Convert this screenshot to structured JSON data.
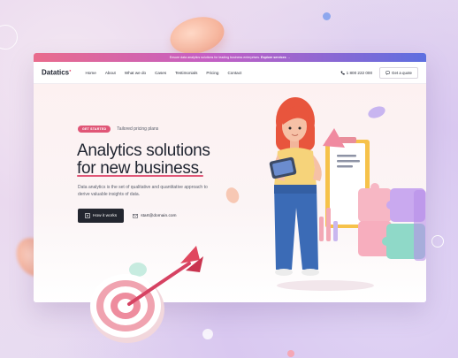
{
  "promo": {
    "text": "Ensure data analytics solutions for leading business enterprises.",
    "link": "Explore services →"
  },
  "nav": {
    "logo": "Datatics",
    "links": [
      "Home",
      "About",
      "What we do",
      "Cases",
      "Testimonials",
      "Pricing",
      "Contact"
    ],
    "phone": "1 800 222 000",
    "quote_button": "Get a quote"
  },
  "hero": {
    "tag": "GET STARTED",
    "tag_caption": "Tailored pricing plans",
    "headline_line1": "Analytics solutions",
    "headline_line2": "for new business.",
    "subtext": "Data analytics is the set of qualitative and quantitative approach to derive valuable insights of data.",
    "cta_button": "How it works",
    "email": "start@domain.com"
  },
  "colors": {
    "accent": "#e05677",
    "dark": "#23262f",
    "gradient_start": "#e96b8c",
    "gradient_end": "#5d6fe0"
  },
  "icons": {
    "phone": "phone-icon",
    "quote": "chat-icon",
    "play": "play-icon",
    "mail": "mail-icon"
  }
}
